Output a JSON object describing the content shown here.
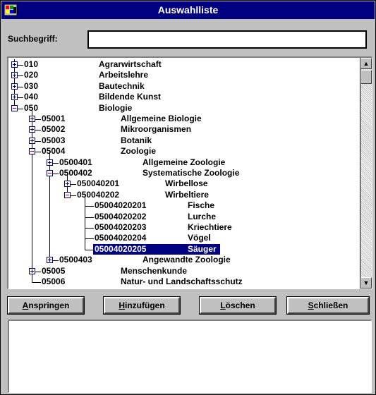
{
  "window": {
    "title": "Auswahlliste"
  },
  "search": {
    "label": "Suchbegriff:",
    "value": ""
  },
  "tree": {
    "rows": [
      {
        "code": "010",
        "name": "Agrarwirtschaft",
        "level": 0,
        "expander": "plus"
      },
      {
        "code": "020",
        "name": "Arbeitslehre",
        "level": 0,
        "expander": "plus"
      },
      {
        "code": "030",
        "name": "Bautechnik",
        "level": 0,
        "expander": "plus"
      },
      {
        "code": "040",
        "name": "Bildende Kunst",
        "level": 0,
        "expander": "plus"
      },
      {
        "code": "050",
        "name": "Biologie",
        "level": 0,
        "expander": "minus"
      },
      {
        "code": "05001",
        "name": "Allgemeine Biologie",
        "level": 1,
        "expander": "plus"
      },
      {
        "code": "05002",
        "name": "Mikroorganismen",
        "level": 1,
        "expander": "plus"
      },
      {
        "code": "05003",
        "name": "Botanik",
        "level": 1,
        "expander": "plus"
      },
      {
        "code": "05004",
        "name": "Zoologie",
        "level": 1,
        "expander": "minus"
      },
      {
        "code": "0500401",
        "name": "Allgemeine Zoologie",
        "level": 2,
        "expander": "plus"
      },
      {
        "code": "0500402",
        "name": "Systematische Zoologie",
        "level": 2,
        "expander": "minus"
      },
      {
        "code": "050040201",
        "name": "Wirbellose",
        "level": 3,
        "expander": "plus"
      },
      {
        "code": "050040202",
        "name": "Wirbeltiere",
        "level": 3,
        "expander": "minus"
      },
      {
        "code": "05004020201",
        "name": "Fische",
        "level": 4,
        "expander": "none"
      },
      {
        "code": "05004020202",
        "name": "Lurche",
        "level": 4,
        "expander": "none"
      },
      {
        "code": "05004020203",
        "name": "Kriechtiere",
        "level": 4,
        "expander": "none"
      },
      {
        "code": "05004020204",
        "name": "Vögel",
        "level": 4,
        "expander": "none"
      },
      {
        "code": "05004020205",
        "name": "Säuger",
        "level": 4,
        "expander": "none",
        "selected": true
      },
      {
        "code": "0500403",
        "name": "Angewandte Zoologie",
        "level": 2,
        "expander": "plus"
      },
      {
        "code": "05005",
        "name": "Menschenkunde",
        "level": 1,
        "expander": "plus"
      },
      {
        "code": "05006",
        "name": "Natur- und Landschaftsschutz",
        "level": 1,
        "expander": "none"
      }
    ]
  },
  "buttons": {
    "jump": {
      "mnemonic": "A",
      "rest": "nspringen"
    },
    "add": {
      "mnemonic": "H",
      "rest": "inzufügen"
    },
    "delete": {
      "mnemonic": "L",
      "rest": "öschen"
    },
    "close": {
      "mnemonic": "S",
      "rest": "chließen"
    }
  },
  "output": {
    "value": ""
  },
  "colors": {
    "titlebar": "#000080",
    "selection": "#000080",
    "minus_sign": "#c00000",
    "plus_sign": "#000080",
    "face": "#c0c0c0"
  },
  "icons": {
    "sysmenu": "app-icon",
    "scroll_up": "arrow-up-icon",
    "scroll_down": "arrow-down-icon"
  }
}
